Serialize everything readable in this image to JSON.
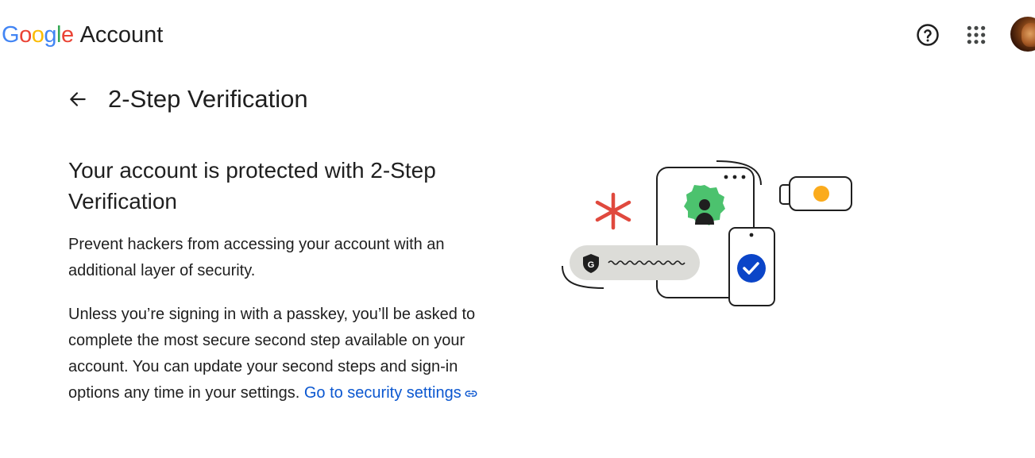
{
  "header": {
    "logo_word": [
      "G",
      "o",
      "o",
      "g",
      "l",
      "e"
    ],
    "product_name": "Account",
    "help_icon": "help-circle-icon",
    "apps_icon": "apps-grid-icon",
    "avatar_icon": "account-avatar"
  },
  "page": {
    "title": "2-Step Verification",
    "back_icon": "arrow-back-icon"
  },
  "main": {
    "heading": "Your account is protected with 2-Step Verification",
    "paragraph1": "Prevent hackers from accessing your account with an additional layer of security.",
    "paragraph2_text": "Unless you’re signing in with a passkey, you’ll be asked to complete the most secure second step available on your account. You can update your second steps and sign-in options any time in your settings. ",
    "paragraph2_link": "Go to security settings",
    "link_icon": "link-icon"
  },
  "colors": {
    "google_blue": "#4285f4",
    "google_red": "#ea4335",
    "google_yellow": "#fbbc05",
    "google_green": "#34a853",
    "link": "#0b57d0",
    "text": "#1f1f1f"
  },
  "illustration": {
    "shield_letter": "G",
    "icons": [
      "asterisk-icon",
      "phone-icon",
      "user-badge-icon",
      "security-key-icon",
      "check-icon",
      "shield-icon"
    ]
  }
}
